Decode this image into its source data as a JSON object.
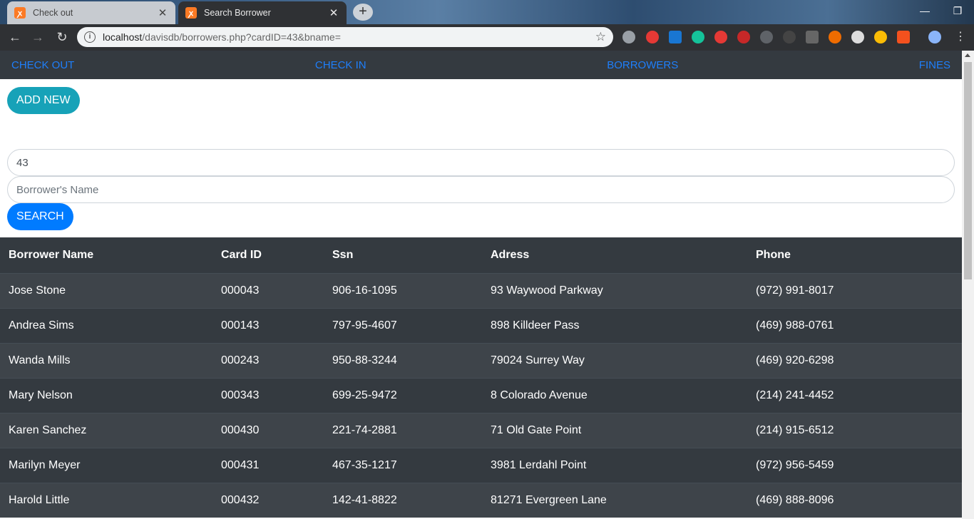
{
  "browser": {
    "tabs": [
      {
        "title": "Check out",
        "active": false
      },
      {
        "title": "Search Borrower",
        "active": true
      }
    ],
    "new_tab_label": "+",
    "url_host": "localhost",
    "url_path": "/davisdb/borrowers.php?cardID=43&bname=",
    "icons": {
      "back": "back-arrow-icon",
      "forward": "forward-arrow-icon",
      "reload": "reload-icon",
      "info": "info-icon",
      "star": "bookmark-star-icon",
      "menu": "kebab-menu-icon"
    }
  },
  "nav": {
    "items": [
      {
        "label": "CHECK OUT"
      },
      {
        "label": "CHECK IN"
      },
      {
        "label": "BORROWERS"
      },
      {
        "label": "FINES"
      }
    ]
  },
  "actions": {
    "add_new": "ADD NEW",
    "search": "SEARCH"
  },
  "search": {
    "card_id_value": "43",
    "name_placeholder": "Borrower's Name"
  },
  "table": {
    "headers": [
      "Borrower Name",
      "Card ID",
      "Ssn",
      "Adress",
      "Phone"
    ],
    "rows": [
      [
        "Jose Stone",
        "000043",
        "906-16-1095",
        "93 Waywood Parkway",
        "(972) 991-8017"
      ],
      [
        "Andrea Sims",
        "000143",
        "797-95-4607",
        "898 Killdeer Pass",
        "(469) 988-0761"
      ],
      [
        "Wanda Mills",
        "000243",
        "950-88-3244",
        "79024 Surrey Way",
        "(469) 920-6298"
      ],
      [
        "Mary Nelson",
        "000343",
        "699-25-9472",
        "8 Colorado Avenue",
        "(214) 241-4452"
      ],
      [
        "Karen Sanchez",
        "000430",
        "221-74-2881",
        "71 Old Gate Point",
        "(214) 915-6512"
      ],
      [
        "Marilyn Meyer",
        "000431",
        "467-35-1217",
        "3981 Lerdahl Point",
        "(972) 956-5459"
      ],
      [
        "Harold Little",
        "000432",
        "142-41-8822",
        "81271 Evergreen Lane",
        "(469) 888-8096"
      ]
    ]
  },
  "colors": {
    "nav_bg": "#343a40",
    "nav_link": "#1e7ffb",
    "add_btn": "#17a2b8",
    "search_btn": "#007bff"
  }
}
